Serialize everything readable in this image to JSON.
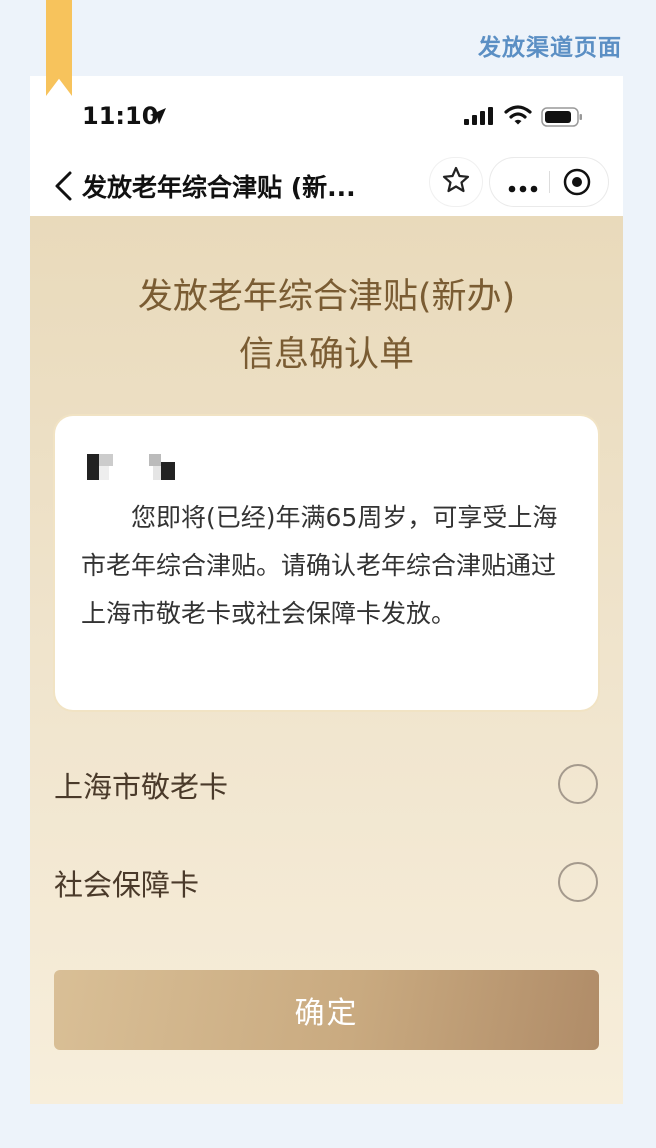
{
  "page_label": "发放渠道页面",
  "status_bar": {
    "time": "11:10"
  },
  "nav": {
    "title": "发放老年综合津贴 (新..."
  },
  "main": {
    "title_line1": "发放老年综合津贴(新办)",
    "title_line2": "信息确认单",
    "card_text": "您即将(已经)年满65周岁，可享受上海市老年综合津贴。请确认老年综合津贴通过上海市敬老卡或社会保障卡发放。",
    "options": [
      {
        "label": "上海市敬老卡",
        "selected": false
      },
      {
        "label": "社会保障卡",
        "selected": false
      }
    ],
    "confirm_label": "确定"
  },
  "colors": {
    "accent_brown": "#7a5c33",
    "page_label_blue": "#5b8fc4",
    "ribbon_yellow": "#f7c35c"
  },
  "icons": [
    "location-arrow-icon",
    "signal-icon",
    "wifi-icon",
    "battery-icon",
    "back-chevron-icon",
    "star-icon",
    "more-dots-icon",
    "target-icon"
  ]
}
